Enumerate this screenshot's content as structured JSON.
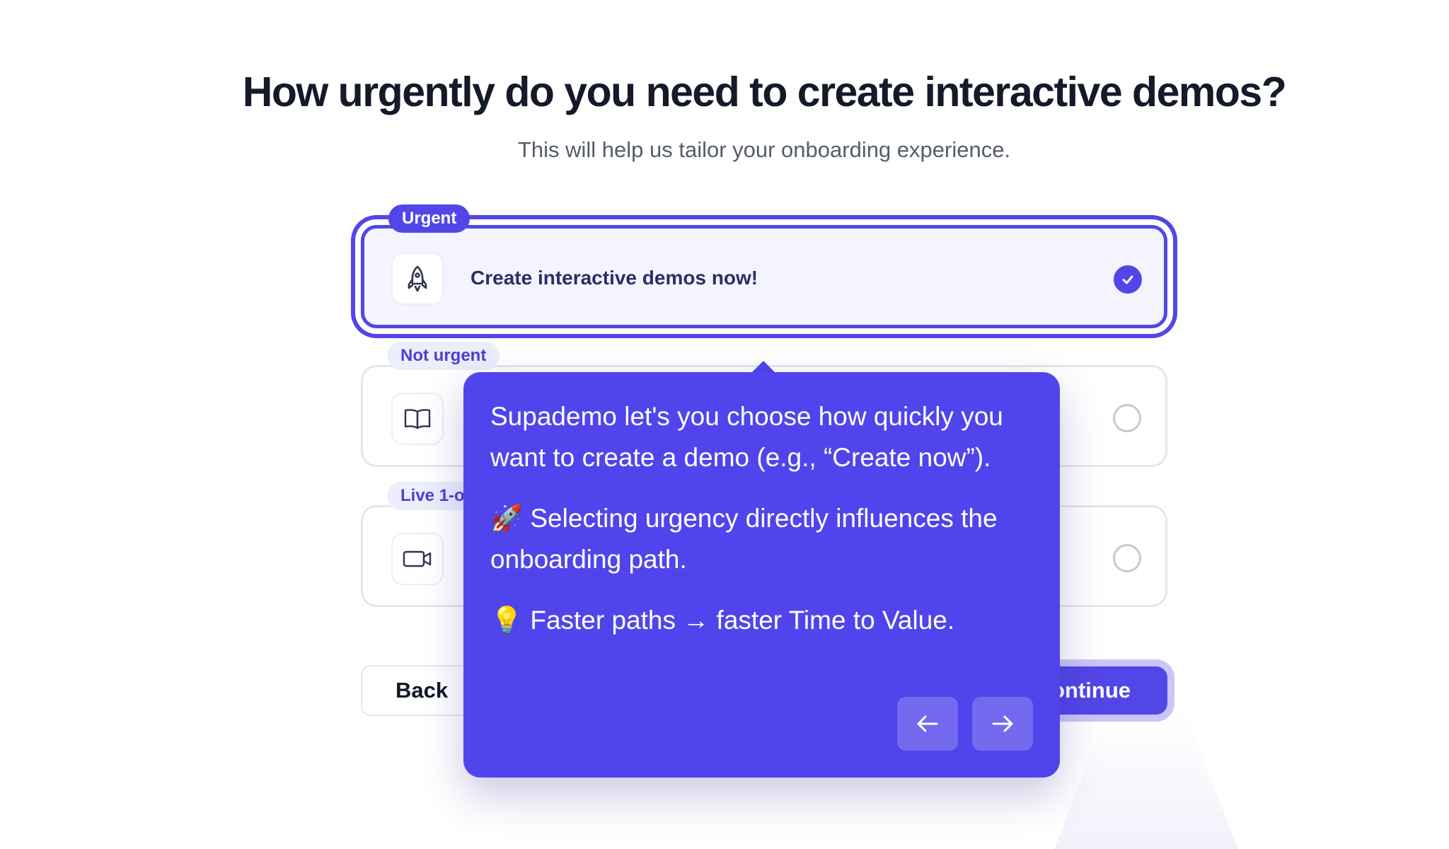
{
  "header": {
    "title": "How urgently do you need to create interactive demos?",
    "subtitle": "This will help us tailor your onboarding experience."
  },
  "options": [
    {
      "tag": "Urgent",
      "label": "Create interactive demos now!",
      "icon": "rocket-icon",
      "selected": true
    },
    {
      "tag": "Not urgent",
      "label": "",
      "icon": "book-open-icon",
      "selected": false
    },
    {
      "tag": "Live 1-or",
      "label": "",
      "icon": "video-camera-icon",
      "selected": false
    }
  ],
  "footer": {
    "back_label": "Back",
    "continue_label": "ontinue"
  },
  "tooltip": {
    "paragraphs": [
      "Supademo let's you choose how quickly you want to create a demo (e.g., “Create now”).",
      "🚀 Selecting urgency directly influences the onboarding path.",
      "💡 Faster paths → faster Time to Value."
    ]
  },
  "colors": {
    "accent": "#5246e8",
    "tooltip_bg": "#5045ec",
    "title": "#141a29",
    "subtitle": "#545c6b"
  }
}
